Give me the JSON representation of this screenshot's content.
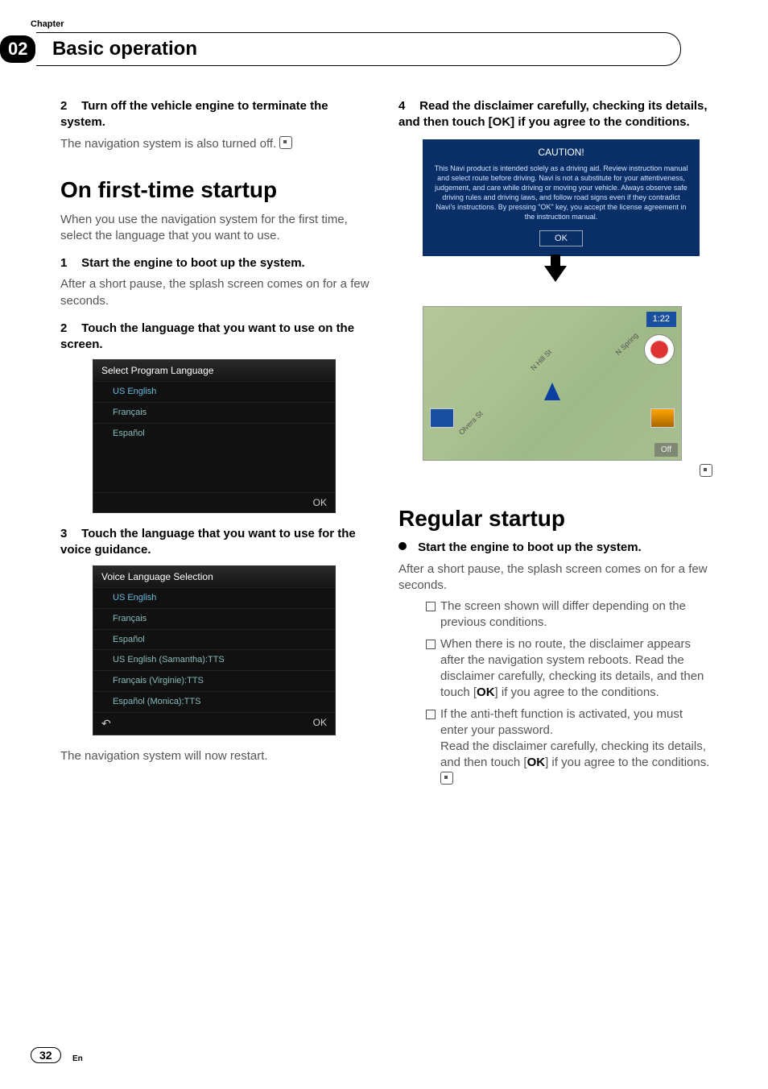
{
  "header": {
    "chapter_label": "Chapter",
    "chapter_number": "02",
    "title": "Basic operation"
  },
  "left": {
    "step2_title_a": "2",
    "step2_title_b": "Turn off the vehicle engine to terminate the system.",
    "step2_body": "The navigation system is also turned off.",
    "h_first": "On first-time startup",
    "first_intro": "When you use the navigation system for the first time, select the language that you want to use.",
    "s1_num": "1",
    "s1_title": "Start the engine to boot up the system.",
    "s1_body": "After a short pause, the splash screen comes on for a few seconds.",
    "s2_num": "2",
    "s2_title": "Touch the language that you want to use on the screen.",
    "lang_panel": {
      "header": "Select Program Language",
      "items": [
        "US English",
        "Français",
        "Español"
      ],
      "ok": "OK"
    },
    "s3_num": "3",
    "s3_title": "Touch the language that you want to use for the voice guidance.",
    "voice_panel": {
      "header": "Voice Language Selection",
      "items": [
        "US English",
        "Français",
        "Español",
        "US English (Samantha):TTS",
        "Français (Virginie):TTS",
        "Español (Monica):TTS"
      ],
      "ok": "OK",
      "back": "↶"
    },
    "restart": "The navigation system will now restart."
  },
  "right": {
    "s4_num": "4",
    "s4_title": "Read the disclaimer carefully, checking its details, and then touch [OK] if you agree to the conditions.",
    "caution": {
      "title": "CAUTION!",
      "body": "This Navi product is intended solely as a driving aid. Review instruction manual and select route before driving. Navi is not a substitute for your attentiveness, judgement, and care while driving or moving your vehicle. Always observe safe driving rules and driving laws, and follow road signs even if they contradict Navi's instructions. By pressing \"OK\" key, you accept the license agreement in the instruction manual.",
      "ok": "OK"
    },
    "map": {
      "clock": "1:22",
      "off": "Off",
      "street1": "N Hill St",
      "street2": "Olvera St",
      "street3": "N Spring"
    },
    "h_regular": "Regular startup",
    "reg_bullet_title": "Start the engine to boot up the system.",
    "reg_body": "After a short pause, the splash screen comes on for a few seconds.",
    "notes": {
      "n1": "The screen shown will differ depending on the previous conditions.",
      "n2a": "When there is no route, the disclaimer appears after the navigation system reboots. Read the disclaimer carefully, checking its details, and then touch [",
      "n2b": "OK",
      "n2c": "] if you agree to the conditions.",
      "n3a": "If the anti-theft function is activated, you must enter your password.",
      "n3b": "Read the disclaimer carefully, checking its details, and then touch [",
      "n3c": "OK",
      "n3d": "] if you agree to the conditions."
    }
  },
  "footer": {
    "page": "32",
    "lang": "En"
  }
}
